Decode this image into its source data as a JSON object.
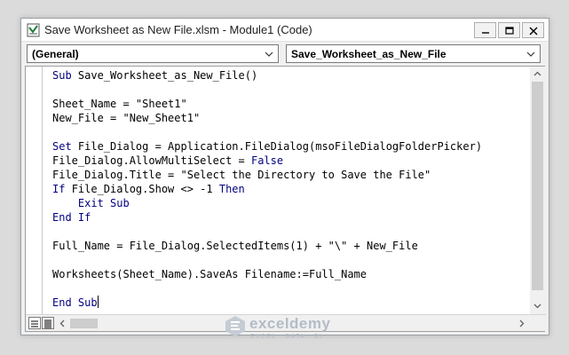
{
  "window": {
    "title": "Save Worksheet as New File.xlsm - Module1 (Code)"
  },
  "toolbar": {
    "object_combo": "(General)",
    "procedure_combo": "Save_Worksheet_as_New_File"
  },
  "code": {
    "lines": [
      [
        {
          "t": "Sub ",
          "k": true
        },
        {
          "t": "Save_Worksheet_as_New_File()"
        }
      ],
      [],
      [
        {
          "t": "Sheet_Name = \"Sheet1\""
        }
      ],
      [
        {
          "t": "New_File = \"New_Sheet1\""
        }
      ],
      [],
      [
        {
          "t": "Set ",
          "k": true
        },
        {
          "t": "File_Dialog = Application.FileDialog(msoFileDialogFolderPicker)"
        }
      ],
      [
        {
          "t": "File_Dialog.AllowMultiSelect = "
        },
        {
          "t": "False",
          "k": true
        }
      ],
      [
        {
          "t": "File_Dialog.Title = \"Select the Directory to Save the File\""
        }
      ],
      [
        {
          "t": "If ",
          "k": true
        },
        {
          "t": "File_Dialog.Show <> -1 "
        },
        {
          "t": "Then",
          "k": true
        }
      ],
      [
        {
          "t": "    "
        },
        {
          "t": "Exit Sub",
          "k": true
        }
      ],
      [
        {
          "t": "End If",
          "k": true
        }
      ],
      [],
      [
        {
          "t": "Full_Name = File_Dialog.SelectedItems(1) + \"\\\" + New_File"
        }
      ],
      [],
      [
        {
          "t": "Worksheets(Sheet_Name).SaveAs Filename:=Full_Name"
        }
      ],
      [],
      [
        {
          "t": "End Sub",
          "k": true
        }
      ]
    ],
    "caret_line": 16
  },
  "watermark": {
    "name": "exceldemy",
    "tagline": "EXCEL · DATA · BI"
  },
  "colors": {
    "keyword": "#00007f",
    "text": "#000000"
  }
}
